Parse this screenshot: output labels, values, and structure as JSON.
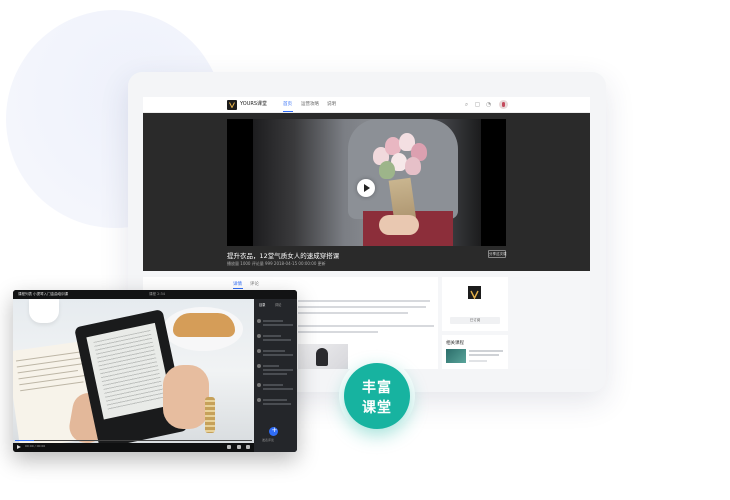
{
  "topnav": {
    "brand": "YOURS课堂",
    "links": [
      "首页",
      "运营攻略",
      "说明"
    ],
    "active_index": 0
  },
  "video": {
    "title": "提升衣品，12堂气质女人的速成穿搭课",
    "meta": "播放量 1000   评论量 999   2018-04-15 00:00:00 更新",
    "share_label": "分享这次课"
  },
  "content": {
    "tabs": [
      "详情",
      "评论"
    ],
    "active_tab": 0
  },
  "sidebar_card": {
    "subscribe_label": "已订阅",
    "related_title": "相关课程"
  },
  "reader": {
    "title": "课程列表  小提琴入门金曲培训课",
    "right_info": "课程  2:34",
    "time": "00:00 / 00:00",
    "tabs": [
      "目录",
      "评论"
    ],
    "progress": 0.08,
    "caption": "发表评论"
  },
  "badge": {
    "line1": "丰富",
    "line2": "课堂"
  },
  "colors": {
    "accent": "#2f6cf6",
    "badge": "#17b3a0",
    "video_band": "#2a2a2a"
  }
}
